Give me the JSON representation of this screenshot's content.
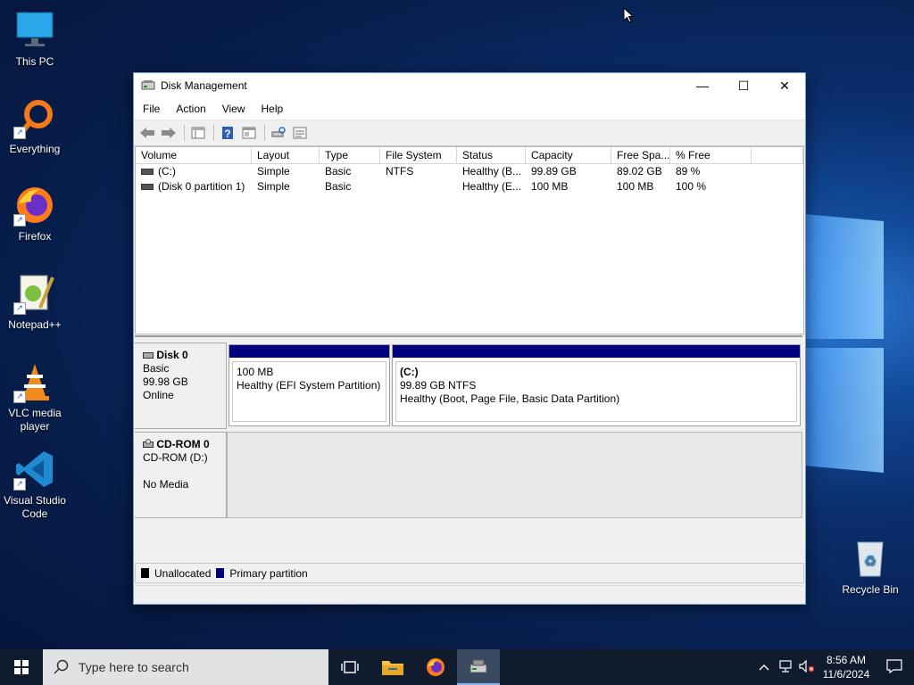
{
  "desktop": {
    "icons": [
      {
        "label": "This PC"
      },
      {
        "label": "Everything"
      },
      {
        "label": "Firefox"
      },
      {
        "label": "Notepad++"
      },
      {
        "label": "VLC media player"
      },
      {
        "label": "Visual Studio Code"
      },
      {
        "label": "Recycle Bin"
      }
    ]
  },
  "window": {
    "title": "Disk Management",
    "controls": {
      "minimize": "—",
      "maximize": "☐",
      "close": "✕"
    },
    "menu": [
      "File",
      "Action",
      "View",
      "Help"
    ],
    "toolbar_icons": [
      "back-arrow-icon",
      "forward-arrow-icon",
      "show-hide-console-tree-icon",
      "help-icon",
      "properties-icon",
      "rescan-disks-icon",
      "settings-list-icon"
    ]
  },
  "volume_list": {
    "columns": [
      "Volume",
      "Layout",
      "Type",
      "File System",
      "Status",
      "Capacity",
      "Free Spa...",
      "% Free",
      ""
    ],
    "rows": [
      [
        "(C:)",
        "Simple",
        "Basic",
        "NTFS",
        "Healthy (B...",
        "99.89 GB",
        "89.02 GB",
        "89 %"
      ],
      [
        "(Disk 0 partition 1)",
        "Simple",
        "Basic",
        "",
        "Healthy (E...",
        "100 MB",
        "100 MB",
        "100 %"
      ]
    ]
  },
  "disks": {
    "disk0": {
      "name": "Disk 0",
      "type": "Basic",
      "size": "99.98 GB",
      "status": "Online",
      "partitions": [
        {
          "name": "",
          "size": "100 MB",
          "status": "Healthy (EFI System Partition)"
        },
        {
          "name": "(C:)",
          "size": "99.89 GB NTFS",
          "status": "Healthy (Boot, Page File, Basic Data Partition)"
        }
      ]
    },
    "cdrom0": {
      "name": "CD-ROM 0",
      "type": "CD-ROM (D:)",
      "status": "No Media"
    }
  },
  "legend": [
    {
      "label": "Unallocated",
      "color": "#000000"
    },
    {
      "label": "Primary partition",
      "color": "#00007f"
    }
  ],
  "taskbar": {
    "search_placeholder": "Type here to search",
    "time": "8:56 AM",
    "date": "11/6/2024"
  },
  "colors": {
    "primary_partition": "#00007f",
    "taskbar": "#101c2e"
  }
}
